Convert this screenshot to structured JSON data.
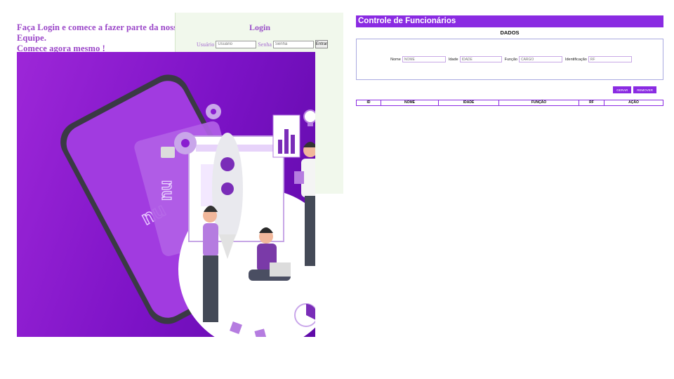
{
  "login_page": {
    "headline_line1": "Faça Login e comece a fazer parte da nossa Equipe.",
    "headline_line2": "Comece agora mesmo !",
    "login_title": "Login",
    "user_label": "Usuário",
    "user_placeholder": "Usuário",
    "password_label": "Senha",
    "password_placeholder": "Senha",
    "enter_button": "Entrar",
    "hero_illustration": {
      "card_text": "nu",
      "phone_text": "nu"
    }
  },
  "dashboard": {
    "header_title": "Controle de Funcionários",
    "section_title": "DADOS",
    "form": {
      "name_label": "Nome",
      "name_placeholder": "NOME",
      "age_label": "Idade",
      "age_placeholder": "IDADE",
      "role_label": "Função",
      "role_placeholder": "CARGO",
      "id_label": "Identificação",
      "id_placeholder": "RF"
    },
    "buttons": {
      "save": "GERAR",
      "remove": "REMOVER"
    },
    "table": {
      "columns": [
        "ID",
        "NOME",
        "IDADE",
        "FUNÇÃO",
        "RF",
        "AÇÃO"
      ]
    }
  },
  "colors": {
    "accent": "#8a2be2",
    "hero_purple": "#8a1fd0",
    "login_bg": "#f1f8ec",
    "headline": "#9a45c8"
  }
}
